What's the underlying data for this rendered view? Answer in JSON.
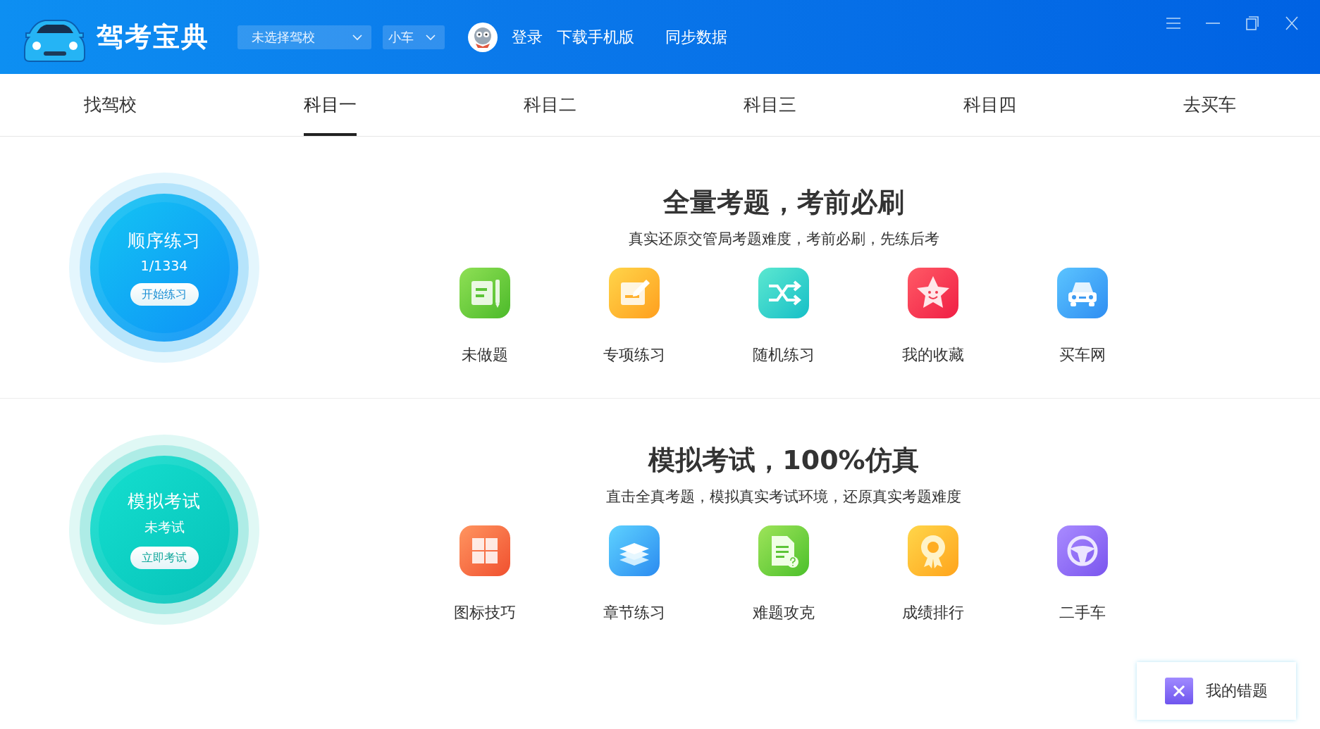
{
  "header": {
    "app_title": "驾考宝典",
    "school_select": {
      "value": "未选择驾校"
    },
    "vehicle_select": {
      "value": "小车"
    },
    "links": [
      "登录",
      "下载手机版",
      "同步数据"
    ]
  },
  "tabs": [
    {
      "label": "找驾校",
      "selected": false
    },
    {
      "label": "科目一",
      "selected": true
    },
    {
      "label": "科目二",
      "selected": false
    },
    {
      "label": "科目三",
      "selected": false
    },
    {
      "label": "科目四",
      "selected": false
    },
    {
      "label": "去买车",
      "selected": false
    }
  ],
  "sections": [
    {
      "kind": "practice",
      "circle": {
        "title": "顺序练习",
        "subtitle": "1/1334",
        "button": "开始练习"
      },
      "headline": "全量考题，考前必刷",
      "subheadline": "真实还原交管局考题难度，考前必刷，先练后考",
      "tiles": [
        {
          "kind": "notebook",
          "label": "未做题"
        },
        {
          "kind": "note-edit",
          "label": "专项练习"
        },
        {
          "kind": "shuffle",
          "label": "随机练习"
        },
        {
          "kind": "star",
          "label": "我的收藏"
        },
        {
          "kind": "car",
          "label": "买车网"
        }
      ]
    },
    {
      "kind": "exam",
      "circle": {
        "title": "模拟考试",
        "subtitle": "未考试",
        "button": "立即考试"
      },
      "headline": "模拟考试，100%仿真",
      "subheadline": "直击全真考题，模拟真实考试环境，还原真实考题难度",
      "tiles": [
        {
          "kind": "grid",
          "label": "图标技巧"
        },
        {
          "kind": "layers",
          "label": "章节练习"
        },
        {
          "kind": "question-doc",
          "label": "难题攻克"
        },
        {
          "kind": "medal",
          "label": "成绩排行"
        },
        {
          "kind": "wheel",
          "label": "二手车"
        }
      ]
    }
  ],
  "mistakes_button": {
    "label": "我的错题"
  }
}
